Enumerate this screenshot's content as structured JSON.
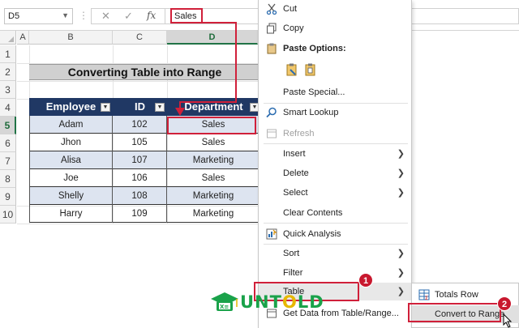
{
  "formula_bar": {
    "name_box": "D5",
    "cancel_symbol": "✕",
    "enter_symbol": "✓",
    "fx_symbol": "fx",
    "value": "Sales"
  },
  "columns": [
    "A",
    "B",
    "C",
    "D"
  ],
  "rows": [
    "1",
    "2",
    "3",
    "4",
    "5",
    "6",
    "7",
    "8",
    "9",
    "10"
  ],
  "sheet": {
    "title": "Converting Table into Range",
    "table_headers": [
      "Employee",
      "ID",
      "Department"
    ],
    "table_rows": [
      [
        "Adam",
        "102",
        "Sales"
      ],
      [
        "Jhon",
        "105",
        "Sales"
      ],
      [
        "Alisa",
        "107",
        "Marketing"
      ],
      [
        "Joe",
        "106",
        "Sales"
      ],
      [
        "Shelly",
        "108",
        "Marketing"
      ],
      [
        "Harry",
        "109",
        "Marketing"
      ]
    ]
  },
  "context_menu": {
    "cut": "Cut",
    "copy": "Copy",
    "paste_options": "Paste Options:",
    "paste_special": "Paste Special...",
    "smart_lookup": "Smart Lookup",
    "refresh": "Refresh",
    "insert": "Insert",
    "delete": "Delete",
    "select": "Select",
    "clear_contents": "Clear Contents",
    "quick_analysis": "Quick Analysis",
    "sort": "Sort",
    "filter": "Filter",
    "table": "Table",
    "get_data": "Get Data from Table/Range..."
  },
  "submenu": {
    "totals_row": "Totals Row",
    "convert_to_range": "Convert to Range"
  },
  "badges": [
    "1",
    "2"
  ],
  "logo": {
    "text_before": "UNT",
    "text_o": "O",
    "text_after": "LD"
  },
  "colors": {
    "table_header": "#203864",
    "table_alt_row": "#dde4f0",
    "highlight": "#d0203a",
    "excel_green": "#217346",
    "logo_green": "#1aa24a"
  },
  "icons": {
    "cut": "scissors-icon",
    "copy": "copy-icon",
    "paste": "paste-icon",
    "smart_lookup": "search-icon",
    "refresh": "refresh-icon",
    "quick_analysis": "quick-analysis-icon",
    "totals_row": "table-icon",
    "submenu_chevron": "chevron-right-icon"
  }
}
